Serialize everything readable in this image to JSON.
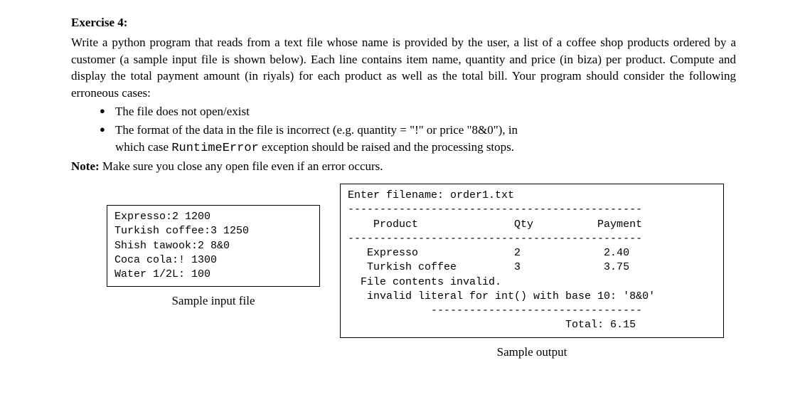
{
  "title": "Exercise 4:",
  "p1": "Write a python program that reads from a text file whose name is provided by the user, a list of a coffee shop products ordered by a customer (a sample input file is shown below). Each line contains item name, quantity and price (in biza) per product. Compute and display the total payment amount (in riyals) for each product as well as the total bill. Your program should consider the following erroneous cases:",
  "bullets": {
    "b1": "The file does not open/exist",
    "b2a": "The format of the data in the file is incorrect (e.g. quantity = \"!\" or price \"8&0\"), in",
    "b2b": "which case ",
    "b2c": "RuntimeError",
    "b2d": " exception should be raised and the processing stops."
  },
  "note_label": "Note:",
  "note_text": " Make sure you close any open file even if an error occurs.",
  "input_box": "Expresso:2 1200\nTurkish coffee:3 1250\nShish tawook:2 8&0\nCoca cola:! 1300\nWater 1/2L: 100\n",
  "output_box": "Enter filename: order1.txt\n----------------------------------------------\n    Product               Qty          Payment\n----------------------------------------------\n   Expresso               2             2.40\n   Turkish coffee         3             3.75\n  File contents invalid.\n   invalid literal for int() with base 10: '8&0'\n             ---------------------------------\n                                  Total: 6.15",
  "input_caption": "Sample input file",
  "output_caption": "Sample output"
}
